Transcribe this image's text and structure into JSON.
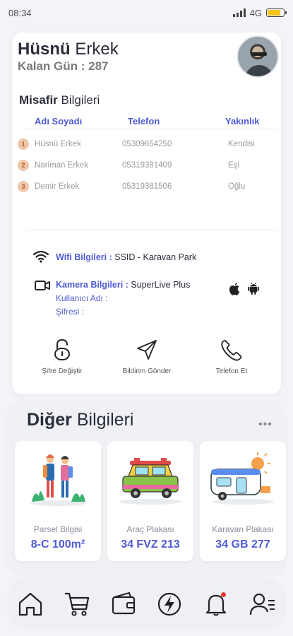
{
  "status_bar": {
    "time": "08:34",
    "network": "4G"
  },
  "user": {
    "first_name": "Hüsnü",
    "last_name": "Erkek",
    "remaining_days": "Kalan Gün : 287"
  },
  "guests": {
    "title_bold": "Misafir",
    "title_rest": "Bilgileri",
    "columns": [
      "Adı Soyadı",
      "Telefon",
      "Yakınlık"
    ],
    "rows": [
      {
        "index": "1",
        "name": "Hüsnü Erkek",
        "phone": "05309654250",
        "relation": "Kendisi"
      },
      {
        "index": "2",
        "name": "Nariman Erkek",
        "phone": "05319381409",
        "relation": "Eşi"
      },
      {
        "index": "3",
        "name": "Demir Erkek",
        "phone": "05319381506",
        "relation": "Oğlu"
      }
    ]
  },
  "wifi": {
    "label": "Wifi Bilgileri :",
    "value": "SSID - Karavan Park"
  },
  "camera": {
    "label": "Kamera Bilgileri :",
    "value": "SuperLive Plus",
    "username_label": "Kullanıcı Adı :",
    "password_label": "Şifresi :"
  },
  "actions": [
    {
      "label": "Şifre Değiştir",
      "icon": "unlock-icon"
    },
    {
      "label": "Bildirim Gönder",
      "icon": "send-icon"
    },
    {
      "label": "Telefon Et",
      "icon": "phone-icon"
    }
  ],
  "other": {
    "title_bold": "Diğer",
    "title_rest": "Bilgileri",
    "tiles": [
      {
        "label": "Parsel Bilgisi",
        "value": "8-C  100m²"
      },
      {
        "label": "Araç Plakası",
        "value": "34 FVZ 213"
      },
      {
        "label": "Karavan Plakası",
        "value": "34 GB 277"
      }
    ]
  },
  "tabs": [
    "home-icon",
    "cart-icon",
    "wallet-icon",
    "lightning-icon",
    "bell-icon",
    "user-list-icon"
  ],
  "colors": {
    "accent": "#4f5bd5",
    "battery": "#f2c31a",
    "badge": "#f1c6a8"
  }
}
